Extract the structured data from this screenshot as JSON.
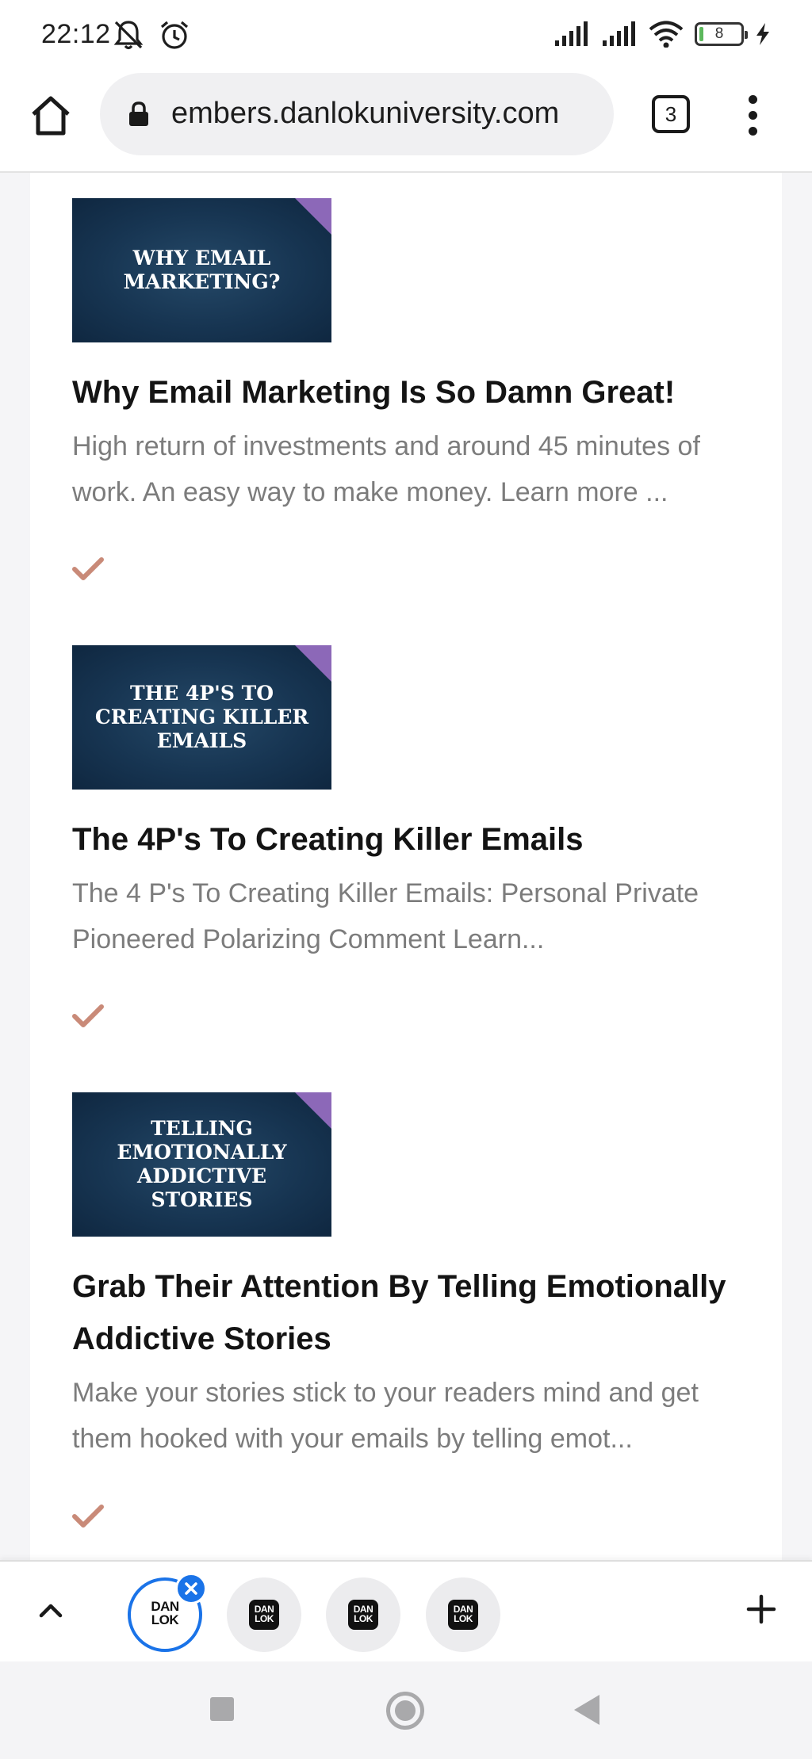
{
  "status_bar": {
    "time": "22:12",
    "battery": "8",
    "icons": [
      "mute-icon",
      "alarm-icon",
      "signal-icon",
      "signal-icon",
      "wifi-icon",
      "battery-icon",
      "charging-icon"
    ]
  },
  "toolbar": {
    "url": "embers.danlokuniversity.com",
    "tab_count": "3"
  },
  "lessons": [
    {
      "thumb_text": "WHY EMAIL MARKETING?",
      "title": "Why Email Marketing Is So Damn Great!",
      "description": "High return of investments and around 45 minutes of work. An easy way to make money. Learn more ...",
      "completed": true
    },
    {
      "thumb_text": "THE 4P'S TO CREATING KILLER EMAILS",
      "title": "The 4P's To Creating Killer Emails",
      "description": "The 4 P's To Creating Killer Emails: Personal Private Pioneered Polarizing Comment Learn...",
      "completed": true
    },
    {
      "thumb_text": "TELLING EMOTIONALLY ADDICTIVE STORIES",
      "title": "Grab Their Attention By Telling Emotionally Addictive Stories",
      "description": "Make your stories stick to your readers mind and get them hooked with your emails by telling emot...",
      "completed": true
    }
  ],
  "tab_strip": {
    "tab_logo_line1": "DAN",
    "tab_logo_line2": "LOK"
  },
  "colors": {
    "check": "#c98a78",
    "accent": "#1a73e8",
    "thumb_bg": "#173552",
    "thumb_corner": "#8c68b8"
  }
}
